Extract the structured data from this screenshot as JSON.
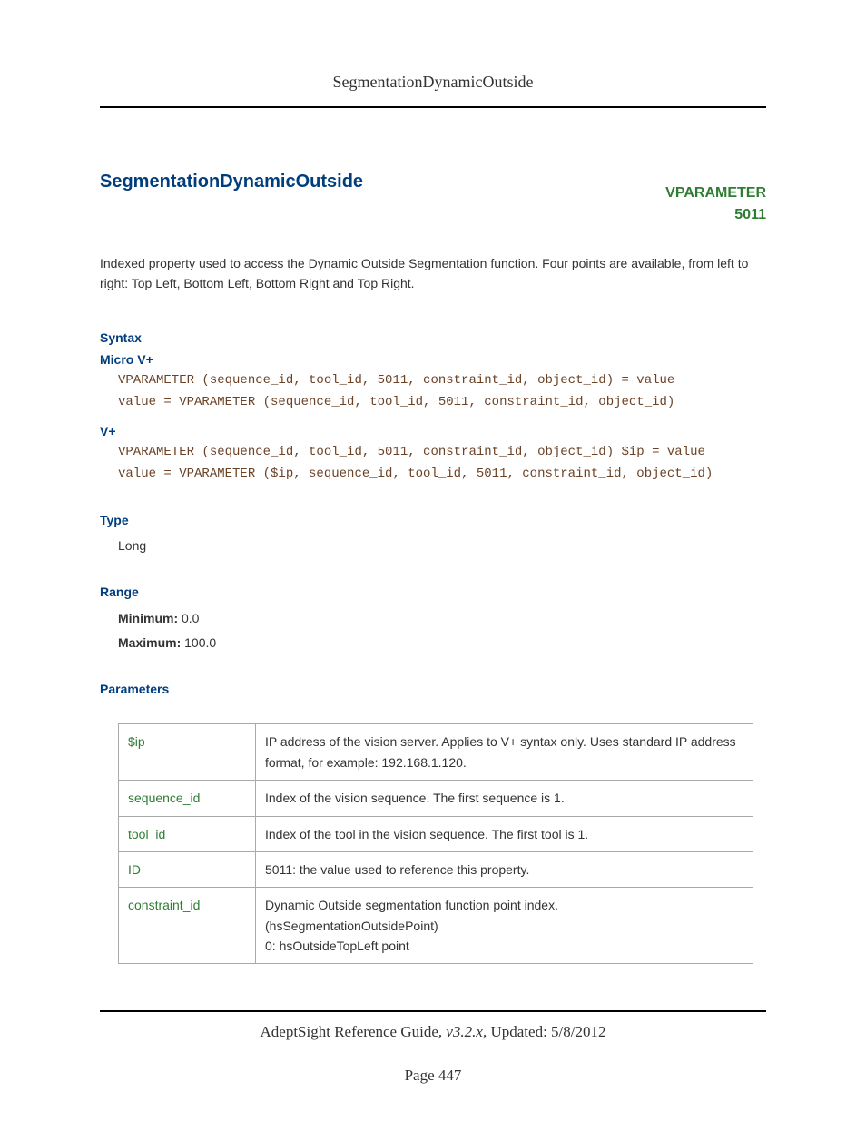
{
  "header": {
    "title": "SegmentationDynamicOutside"
  },
  "main": {
    "title": "SegmentationDynamicOutside",
    "vparam_label": "VPARAMETER",
    "vparam_id": "5011",
    "description": "Indexed property used to access the Dynamic Outside Segmentation function. Four points are available, from left to right: Top Left, Bottom Left, Bottom Right and Top Right."
  },
  "syntax": {
    "heading": "Syntax",
    "micro_label": "Micro V+",
    "micro_code": "VPARAMETER (sequence_id, tool_id, 5011, constraint_id, object_id) = value\nvalue = VPARAMETER (sequence_id, tool_id, 5011, constraint_id, object_id)",
    "vplus_label": "V+",
    "vplus_code": "VPARAMETER (sequence_id, tool_id, 5011, constraint_id, object_id) $ip = value\nvalue = VPARAMETER ($ip, sequence_id, tool_id, 5011, constraint_id, object_id)"
  },
  "type": {
    "heading": "Type",
    "value": "Long"
  },
  "range": {
    "heading": "Range",
    "min_label": "Minimum:",
    "min_value": " 0.0",
    "max_label": "Maximum:",
    "max_value": " 100.0"
  },
  "parameters": {
    "heading": "Parameters",
    "rows": [
      {
        "name": "$ip",
        "desc": "IP address of the vision server. Applies to V+ syntax only. Uses standard IP address format, for example: 192.168.1.120."
      },
      {
        "name": "sequence_id",
        "desc": "Index of the vision sequence. The first sequence is 1."
      },
      {
        "name": "tool_id",
        "desc": "Index of the tool in the vision sequence. The first tool is 1."
      },
      {
        "name": "ID",
        "desc": "5011: the value used to reference this property."
      },
      {
        "name": "constraint_id",
        "desc": "Dynamic Outside segmentation function point index.\n(hsSegmentationOutsidePoint)\n0: hsOutsideTopLeft point"
      }
    ]
  },
  "footer": {
    "guide": "AdeptSight Reference Guide",
    "version": ", v3.2.x",
    "updated": ", Updated: 5/8/2012",
    "page": "Page 447"
  }
}
